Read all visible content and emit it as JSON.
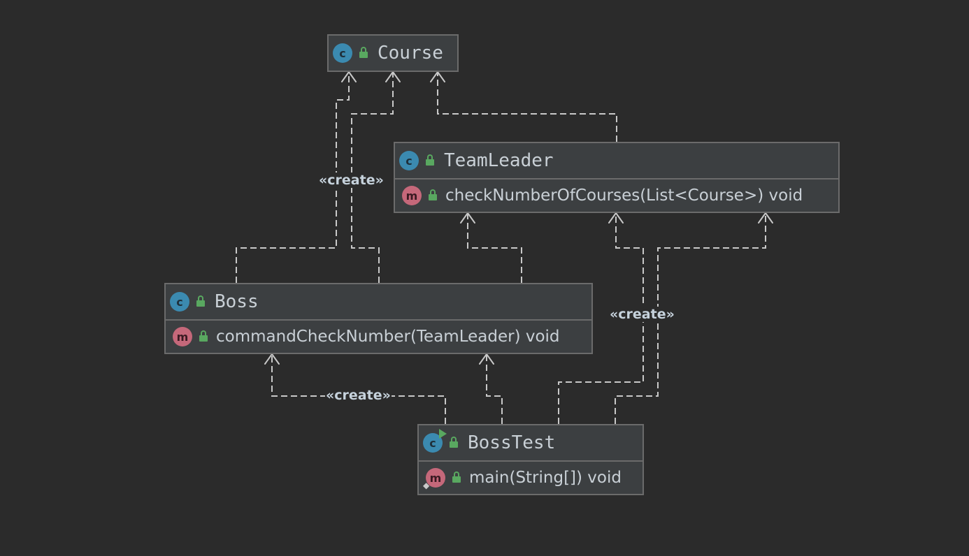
{
  "classes": {
    "course": {
      "name": "Course"
    },
    "team_leader": {
      "name": "TeamLeader",
      "method": "checkNumberOfCourses(List<Course>) void"
    },
    "boss": {
      "name": "Boss",
      "method": "commandCheckNumber(TeamLeader) void"
    },
    "boss_test": {
      "name": "BossTest",
      "method": "main(String[]) void"
    }
  },
  "labels": {
    "create_left": "«create»",
    "create_right": "«create»",
    "create_bottom": "«create»"
  },
  "icons": {
    "class_badge": "c",
    "method_badge": "m"
  },
  "colors": {
    "background": "#2b2b2b",
    "node_fill": "#3c3f41",
    "node_border": "#6b6b6b",
    "class_badge": "#3b8ab0",
    "method_badge": "#c5687a",
    "lock": "#59a860",
    "edge": "#c9c9c9"
  }
}
